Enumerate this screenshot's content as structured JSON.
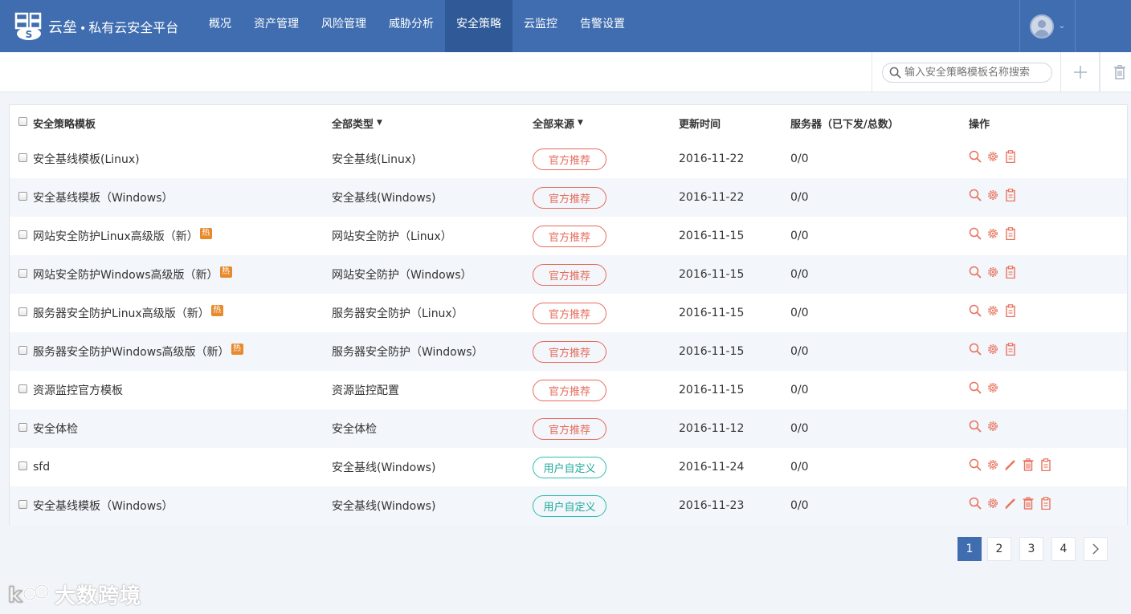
{
  "app": {
    "brand_main": "云垒",
    "brand_dot": "•",
    "brand_sub": "私有云安全平台"
  },
  "nav": {
    "items": [
      {
        "label": "概况"
      },
      {
        "label": "资产管理"
      },
      {
        "label": "风险管理"
      },
      {
        "label": "威胁分析"
      },
      {
        "label": "安全策略",
        "active": true
      },
      {
        "label": "云监控"
      },
      {
        "label": "告警设置"
      }
    ]
  },
  "toolbar": {
    "search_placeholder": "输入安全策略模板名称搜索",
    "add_icon": "plus-icon",
    "delete_icon": "trash-icon"
  },
  "table": {
    "headers": {
      "name": "安全策略模板",
      "type": "全部类型",
      "source": "全部来源",
      "time": "更新时间",
      "servers": "服务器（已下发/总数）",
      "ops": "操作"
    },
    "rows": [
      {
        "name": "安全基线模板(Linux)",
        "hot": false,
        "type": "安全基线(Linux)",
        "source": "官方推荐",
        "source_kind": "official",
        "time": "2016-11-22",
        "servers": "0/0",
        "ops": [
          "view",
          "settings",
          "copy"
        ]
      },
      {
        "name": "安全基线模板（Windows）",
        "hot": false,
        "type": "安全基线(Windows)",
        "source": "官方推荐",
        "source_kind": "official",
        "time": "2016-11-22",
        "servers": "0/0",
        "ops": [
          "view",
          "settings",
          "copy"
        ]
      },
      {
        "name": "网站安全防护Linux高级版（新）",
        "hot": true,
        "type": "网站安全防护（Linux）",
        "source": "官方推荐",
        "source_kind": "official",
        "time": "2016-11-15",
        "servers": "0/0",
        "ops": [
          "view",
          "settings",
          "copy"
        ]
      },
      {
        "name": "网站安全防护Windows高级版（新）",
        "hot": true,
        "type": "网站安全防护（Windows）",
        "source": "官方推荐",
        "source_kind": "official",
        "time": "2016-11-15",
        "servers": "0/0",
        "ops": [
          "view",
          "settings",
          "copy"
        ]
      },
      {
        "name": "服务器安全防护Linux高级版（新）",
        "hot": true,
        "type": "服务器安全防护（Linux）",
        "source": "官方推荐",
        "source_kind": "official",
        "time": "2016-11-15",
        "servers": "0/0",
        "ops": [
          "view",
          "settings",
          "copy"
        ]
      },
      {
        "name": "服务器安全防护Windows高级版（新）",
        "hot": true,
        "type": "服务器安全防护（Windows）",
        "source": "官方推荐",
        "source_kind": "official",
        "time": "2016-11-15",
        "servers": "0/0",
        "ops": [
          "view",
          "settings",
          "copy"
        ]
      },
      {
        "name": "资源监控官方模板",
        "hot": false,
        "type": "资源监控配置",
        "source": "官方推荐",
        "source_kind": "official",
        "time": "2016-11-15",
        "servers": "0/0",
        "ops": [
          "view",
          "settings"
        ]
      },
      {
        "name": "安全体检",
        "hot": false,
        "type": "安全体检",
        "source": "官方推荐",
        "source_kind": "official",
        "time": "2016-11-12",
        "servers": "0/0",
        "ops": [
          "view",
          "settings"
        ]
      },
      {
        "name": "sfd",
        "hot": false,
        "type": "安全基线(Windows)",
        "source": "用户自定义",
        "source_kind": "custom",
        "time": "2016-11-24",
        "servers": "0/0",
        "ops": [
          "view",
          "settings",
          "edit",
          "delete",
          "copy"
        ]
      },
      {
        "name": "安全基线模板（Windows）",
        "hot": false,
        "type": "安全基线(Windows)",
        "source": "用户自定义",
        "source_kind": "custom",
        "time": "2016-11-23",
        "servers": "0/0",
        "ops": [
          "view",
          "settings",
          "edit",
          "delete",
          "copy"
        ]
      }
    ],
    "hot_label": "热"
  },
  "pagination": {
    "pages": [
      "1",
      "2",
      "3",
      "4"
    ],
    "current": "1",
    "next_icon": "chevron-right-icon"
  },
  "watermark": {
    "text": "大数跨境"
  },
  "colors": {
    "nav_bg": "#3f6db0",
    "nav_active": "#2f5a97",
    "official": "#e66b5b",
    "custom": "#2bbfb0",
    "op_icon": "#e8735f"
  }
}
